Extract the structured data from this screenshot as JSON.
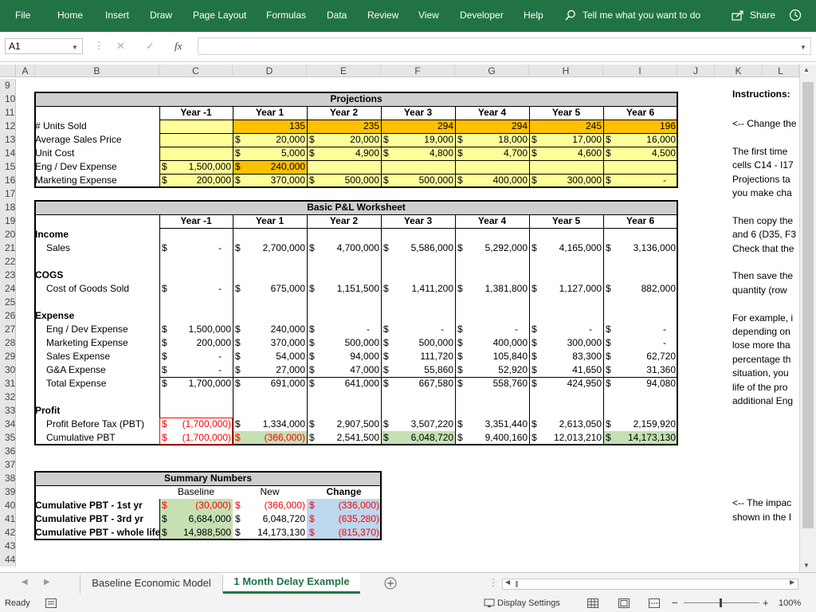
{
  "ribbon": {
    "file": "File",
    "home": "Home",
    "insert": "Insert",
    "draw": "Draw",
    "page_layout": "Page Layout",
    "formulas": "Formulas",
    "data": "Data",
    "review": "Review",
    "view": "View",
    "developer": "Developer",
    "help": "Help",
    "tell_me": "Tell me what you want to do",
    "share": "Share"
  },
  "formula_bar": {
    "name_box": "A1",
    "fx": "fx",
    "value": ""
  },
  "columns": [
    "A",
    "B",
    "C",
    "D",
    "E",
    "F",
    "G",
    "H",
    "I",
    "J",
    "K",
    "L"
  ],
  "rows": [
    "9",
    "10",
    "11",
    "12",
    "13",
    "14",
    "15",
    "16",
    "17",
    "18",
    "19",
    "20",
    "21",
    "22",
    "23",
    "24",
    "25",
    "26",
    "27",
    "28",
    "29",
    "30",
    "31",
    "32",
    "33",
    "34",
    "35",
    "36",
    "37",
    "38",
    "39",
    "40",
    "41",
    "42",
    "43",
    "44"
  ],
  "projections": {
    "title": "Projections",
    "years": [
      "Year -1",
      "Year 1",
      "Year 2",
      "Year 3",
      "Year 4",
      "Year 5",
      "Year 6"
    ],
    "units_label": "# Units Sold",
    "units": [
      "",
      "135",
      "235",
      "294",
      "294",
      "245",
      "196"
    ],
    "price_label": "Average Sales Price",
    "price": [
      "",
      "20,000",
      "20,000",
      "19,000",
      "18,000",
      "17,000",
      "16,000"
    ],
    "cost_label": "Unit Cost",
    "cost": [
      "",
      "5,000",
      "4,900",
      "4,800",
      "4,700",
      "4,600",
      "4,500"
    ],
    "eng_label": "Eng / Dev Expense",
    "eng": [
      "1,500,000",
      "240,000",
      "",
      "",
      "",
      "",
      ""
    ],
    "mkt_label": "Marketing Expense",
    "mkt": [
      "200,000",
      "370,000",
      "500,000",
      "500,000",
      "400,000",
      "300,000",
      "-"
    ]
  },
  "pl": {
    "title": "Basic P&L Worksheet",
    "years": [
      "Year -1",
      "Year 1",
      "Year 2",
      "Year 3",
      "Year 4",
      "Year 5",
      "Year 6"
    ],
    "income": "Income",
    "sales_label": "Sales",
    "sales": [
      "-",
      "2,700,000",
      "4,700,000",
      "5,586,000",
      "5,292,000",
      "4,165,000",
      "3,136,000"
    ],
    "cogs": "COGS",
    "cogs_label": "Cost of Goods Sold",
    "cogs_vals": [
      "-",
      "675,000",
      "1,151,500",
      "1,411,200",
      "1,381,800",
      "1,127,000",
      "882,000"
    ],
    "expense": "Expense",
    "eng_label": "Eng / Dev Expense",
    "eng": [
      "1,500,000",
      "240,000",
      "-",
      "-",
      "-",
      "-",
      "-"
    ],
    "mkt_label": "Marketing Expense",
    "mkt": [
      "200,000",
      "370,000",
      "500,000",
      "500,000",
      "400,000",
      "300,000",
      "-"
    ],
    "se_label": "Sales Expense",
    "se": [
      "-",
      "54,000",
      "94,000",
      "111,720",
      "105,840",
      "83,300",
      "62,720"
    ],
    "ga_label": "G&A Expense",
    "ga": [
      "-",
      "27,000",
      "47,000",
      "55,860",
      "52,920",
      "41,650",
      "31,360"
    ],
    "total_label": "Total Expense",
    "total": [
      "1,700,000",
      "691,000",
      "641,000",
      "667,580",
      "558,760",
      "424,950",
      "94,080"
    ],
    "profit": "Profit",
    "pbt_label": "Profit Before Tax (PBT)",
    "pbt": [
      "(1,700,000)",
      "1,334,000",
      "2,907,500",
      "3,507,220",
      "3,351,440",
      "2,613,050",
      "2,159,920"
    ],
    "cum_label": "Cumulative PBT",
    "cum": [
      "(1,700,000)",
      "(366,000)",
      "2,541,500",
      "6,048,720",
      "9,400,160",
      "12,013,210",
      "14,173,130"
    ]
  },
  "summary": {
    "title": "Summary Numbers",
    "headers": [
      "Baseline",
      "New",
      "Change"
    ],
    "rows": [
      {
        "label": "Cumulative PBT - 1st yr",
        "baseline": "(30,000)",
        "new": "(366,000)",
        "change": "(336,000)"
      },
      {
        "label": "Cumulative PBT - 3rd yr",
        "baseline": "6,684,000",
        "new": "6,048,720",
        "change": "(635,280)"
      },
      {
        "label": "Cumulative PBT - whole life",
        "baseline": "14,988,500",
        "new": "14,173,130",
        "change": "(815,370)"
      }
    ]
  },
  "instructions": {
    "title": "Instructions:",
    "lines": [
      "<-- Change the",
      "",
      "The first time",
      "cells C14 - I17",
      "Projections ta",
      "you make cha",
      "",
      "Then copy the",
      "and 6 (D35, F3",
      "Check that the",
      "",
      "Then save the",
      "quantity (row",
      "",
      "For example, i",
      "depending on",
      "lose more tha",
      "percentage th",
      "situation, you",
      "life of the pro",
      "additional Eng"
    ],
    "impact1": "<-- The impac",
    "impact2": "shown in the I"
  },
  "sheets": {
    "tab1": "Baseline Economic Model",
    "tab2": "1 Month Delay Example"
  },
  "status": {
    "ready": "Ready",
    "display": "Display Settings",
    "zoom": "100%"
  },
  "currency": "$"
}
